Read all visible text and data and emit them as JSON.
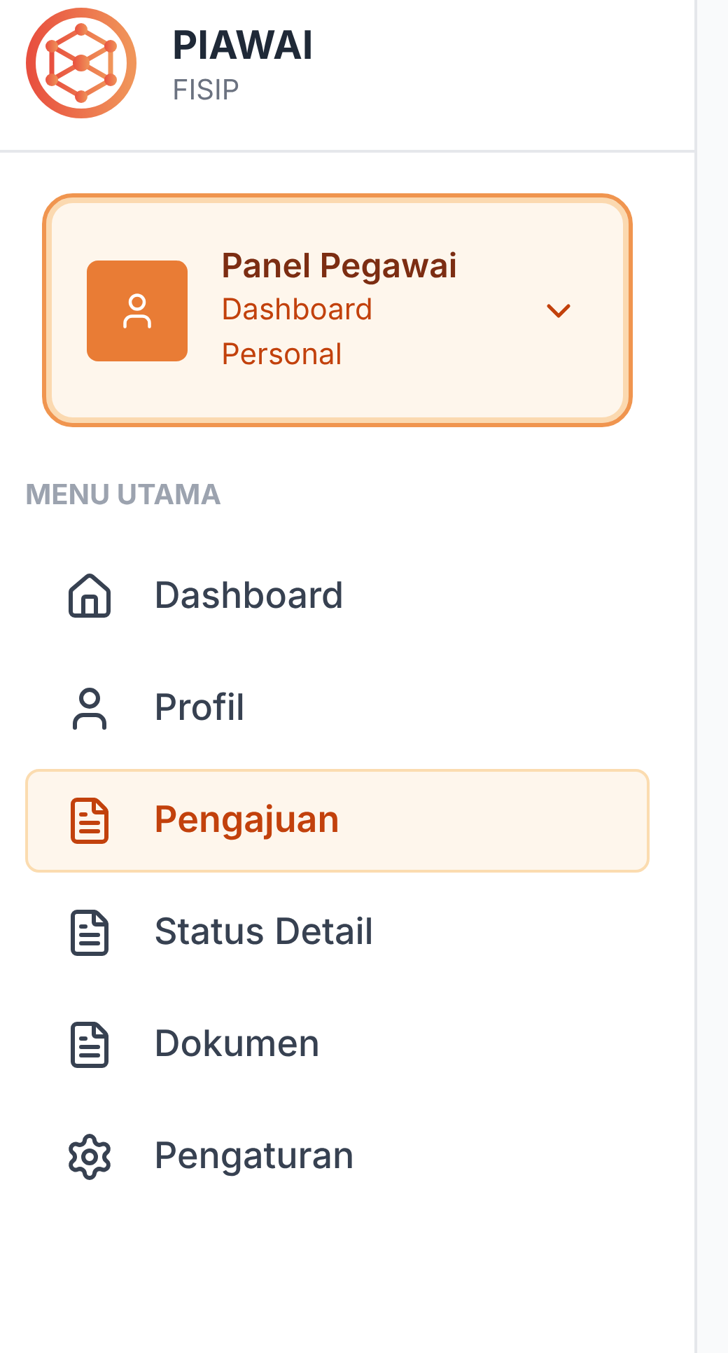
{
  "brand": {
    "title": "PIAWAI",
    "subtitle": "FISIP"
  },
  "panel": {
    "title": "Panel Pegawai",
    "subtitle": "Dashboard Personal",
    "expanded": false
  },
  "section_label": "MENU UTAMA",
  "menu": [
    {
      "label": "Dashboard",
      "selected": false
    },
    {
      "label": "Profil",
      "selected": false
    },
    {
      "label": "Pengajuan",
      "selected": true
    },
    {
      "label": "Status Detail",
      "selected": false
    },
    {
      "label": "Dokumen",
      "selected": false
    },
    {
      "label": "Pengaturan",
      "selected": false
    }
  ]
}
